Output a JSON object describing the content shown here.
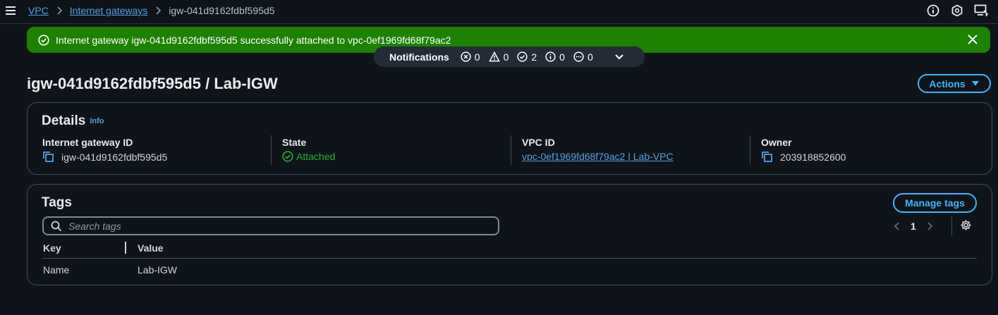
{
  "breadcrumb": {
    "items": [
      "VPC",
      "Internet gateways"
    ],
    "current": "igw-041d9162fdbf595d5"
  },
  "flash": {
    "message": "Internet gateway igw-041d9162fdbf595d5 successfully attached to vpc-0ef1969fd68f79ac2",
    "color": "#1d8102"
  },
  "notifications": {
    "label": "Notifications",
    "error_count": "0",
    "warning_count": "0",
    "success_count": "2",
    "info_count": "0",
    "progress_count": "0"
  },
  "page": {
    "title": "igw-041d9162fdbf595d5 / Lab-IGW",
    "actions_label": "Actions"
  },
  "details": {
    "title": "Details",
    "info": "Info",
    "columns": [
      {
        "label": "Internet gateway ID",
        "value": "igw-041d9162fdbf595d5"
      },
      {
        "label": "State",
        "value": "Attached"
      },
      {
        "label": "VPC ID",
        "value": "vpc-0ef1969fd68f79ac2 | Lab-VPC"
      },
      {
        "label": "Owner",
        "value": "203918852600"
      }
    ]
  },
  "tags": {
    "title": "Tags",
    "manage_label": "Manage tags",
    "search_placeholder": "Search tags",
    "page": "1",
    "headers": {
      "key": "Key",
      "value": "Value"
    },
    "rows": [
      {
        "key": "Name",
        "value": "Lab-IGW"
      }
    ]
  },
  "colors": {
    "background": "#0f141a",
    "link": "#539fe5",
    "accent": "#42b4ff",
    "success": "#29ad32"
  }
}
